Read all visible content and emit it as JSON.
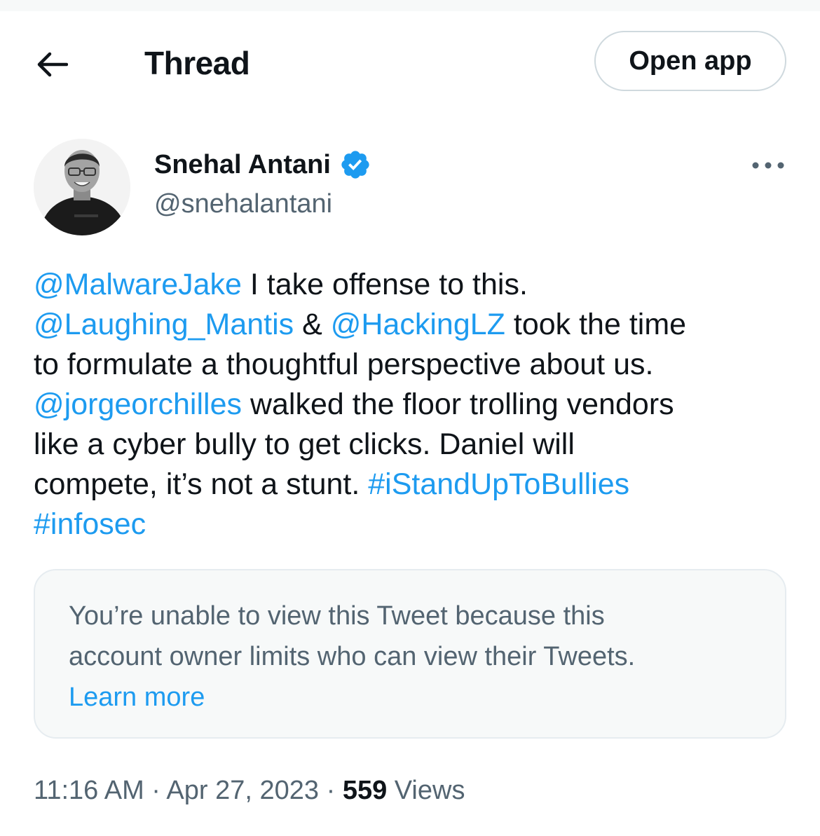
{
  "header": {
    "title": "Thread",
    "open_app_label": "Open app"
  },
  "author": {
    "name": "Snehal Antani",
    "handle": "@snehalantani",
    "verified": true
  },
  "tweet": {
    "lines": [
      [
        {
          "text": "@MalwareJake",
          "link": true
        },
        {
          "text": " I take offense to this.",
          "link": false
        }
      ],
      [
        {
          "text": "@Laughing_Mantis",
          "link": true
        },
        {
          "text": " & ",
          "link": false
        },
        {
          "text": "@HackingLZ",
          "link": true
        },
        {
          "text": " took the time",
          "link": false
        }
      ],
      [
        {
          "text": "to formulate a thoughtful perspective about us.",
          "link": false
        }
      ],
      [
        {
          "text": "@jorgeorchilles",
          "link": true
        },
        {
          "text": " walked the floor trolling vendors",
          "link": false
        }
      ],
      [
        {
          "text": "like a cyber bully to get clicks. Daniel will",
          "link": false
        }
      ],
      [
        {
          "text": "compete, it’s not a stunt. ",
          "link": false
        },
        {
          "text": "#iStandUpToBullies",
          "link": true
        }
      ],
      [
        {
          "text": "#infosec",
          "link": true
        }
      ]
    ]
  },
  "notice": {
    "line1": "You’re unable to view this Tweet because this",
    "line2": "account owner limits who can view their Tweets.",
    "learn_more": "Learn more"
  },
  "meta": {
    "time": "11:16 AM",
    "separator": " · ",
    "date": "Apr 27, 2023",
    "views_count": "559",
    "views_label": " Views"
  },
  "colors": {
    "link": "#1d9bf0",
    "text": "#0f1419",
    "secondary": "#536471",
    "verified_badge": "#1d9bf0"
  },
  "icons": {
    "back": "arrow-left-icon",
    "verified": "verified-badge-icon",
    "more": "more-horizontal-icon"
  }
}
